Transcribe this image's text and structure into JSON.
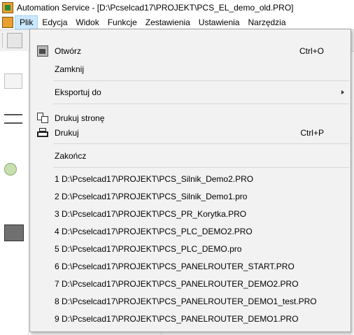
{
  "window": {
    "title": "Automation Service - [D:\\Pcselcad17\\PROJEKT\\PCS_EL_demo_old.PRO]"
  },
  "menubar": {
    "items": [
      {
        "label": "Plik",
        "active": true
      },
      {
        "label": "Edycja"
      },
      {
        "label": "Widok"
      },
      {
        "label": "Funkcje"
      },
      {
        "label": "Zestawienia"
      },
      {
        "label": "Ustawienia"
      },
      {
        "label": "Narzędzia"
      }
    ]
  },
  "file_menu": {
    "open": {
      "label": "Otwórz",
      "shortcut": "Ctrl+O",
      "icon": "open-folder-icon"
    },
    "close": {
      "label": "Zamknij"
    },
    "export": {
      "label": "Eksportuj do",
      "submenu": true
    },
    "print_page": {
      "label": "Drukuj stronę",
      "icon": "print-page-icon"
    },
    "print": {
      "label": "Drukuj",
      "shortcut": "Ctrl+P",
      "icon": "printer-icon"
    },
    "exit": {
      "label": "Zakończ"
    },
    "recent": [
      "1 D:\\Pcselcad17\\PROJEKT\\PCS_Silnik_Demo2.PRO",
      "2 D:\\Pcselcad17\\PROJEKT\\PCS_Silnik_Demo1.pro",
      "3 D:\\Pcselcad17\\PROJEKT\\PCS_PR_Korytka.PRO",
      "4 D:\\Pcselcad17\\PROJEKT\\PCS_PLC_DEMO2.PRO",
      "5 D:\\Pcselcad17\\PROJEKT\\PCS_PLC_DEMO.pro",
      "6 D:\\Pcselcad17\\PROJEKT\\PCS_PANELROUTER_START.PRO",
      "7 D:\\Pcselcad17\\PROJEKT\\PCS_PANELROUTER_DEMO2.PRO",
      "8 D:\\Pcselcad17\\PROJEKT\\PCS_PANELROUTER_DEMO1_test.PRO",
      "9 D:\\Pcselcad17\\PROJEKT\\PCS_PANELROUTER_DEMO1.PRO"
    ]
  },
  "colors": {
    "menu_bg": "#f2f2f2",
    "active_menu": "#cce8ff"
  }
}
